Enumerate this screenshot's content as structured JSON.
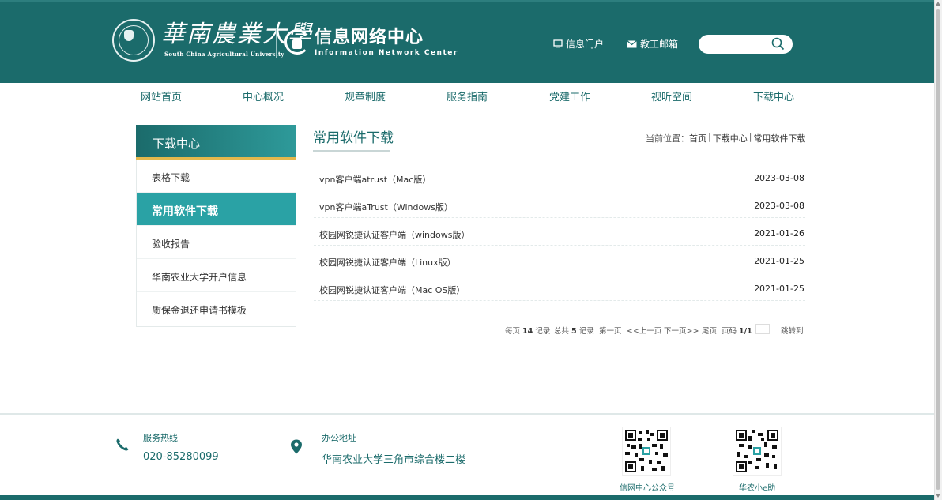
{
  "header": {
    "university_cn": "華南農業大學",
    "university_en": "South China Agricultural University",
    "center_cn": "信息网络中心",
    "center_en": "Information Network Center",
    "links": [
      {
        "label": "信息门户",
        "icon": "monitor-icon"
      },
      {
        "label": "教工邮箱",
        "icon": "mail-icon"
      }
    ],
    "search": {
      "placeholder": "",
      "value": "",
      "icon": "search-icon"
    },
    "colors": {
      "brand": "#1b6b6b",
      "accent": "#2aa2a5",
      "gold": "#e3b84c"
    }
  },
  "nav": {
    "items": [
      {
        "label": "网站首页"
      },
      {
        "label": "中心概况"
      },
      {
        "label": "规章制度"
      },
      {
        "label": "服务指南"
      },
      {
        "label": "党建工作"
      },
      {
        "label": "视听空间"
      },
      {
        "label": "下载中心"
      }
    ]
  },
  "sidebar": {
    "title": "下载中心",
    "items": [
      {
        "label": "表格下载",
        "active": false
      },
      {
        "label": "常用软件下载",
        "active": true
      },
      {
        "label": "验收报告",
        "active": false
      },
      {
        "label": "华南农业大学开户信息",
        "active": false
      },
      {
        "label": "质保金退还申请书模板",
        "active": false
      }
    ]
  },
  "main": {
    "title": "常用软件下载",
    "breadcrumb": {
      "prefix": "当前位置：",
      "items": [
        "首页",
        "下载中心",
        "常用软件下载"
      ],
      "separator": "|"
    },
    "rows": [
      {
        "title": "vpn客户端atrust（Mac版）",
        "date": "2023-03-08"
      },
      {
        "title": "vpn客户端aTrust（Windows版）",
        "date": "2023-03-08"
      },
      {
        "title": "校园网锐捷认证客户端（windows版）",
        "date": "2021-01-26"
      },
      {
        "title": "校园网锐捷认证客户端（Linux版）",
        "date": "2021-01-25"
      },
      {
        "title": "校园网锐捷认证客户端（Mac OS版）",
        "date": "2021-01-25"
      }
    ],
    "pager": {
      "per_page_prefix": "每页",
      "per_page": "14",
      "per_page_suffix": "记录",
      "total_prefix": "总共",
      "total": "5",
      "total_suffix": "记录",
      "first": "第一页",
      "prev": "<<上一页",
      "next": "下一页>>",
      "last": "尾页",
      "page_prefix": "页码",
      "page": "1/1",
      "jump": "跳转到"
    }
  },
  "footer": {
    "hotline_label": "服务热线",
    "hotline": "020-85280099",
    "address_label": "办公地址",
    "address": "华南农业大学三角市综合楼二楼",
    "qr_codes": [
      {
        "caption": "信网中心公众号"
      },
      {
        "caption": "华农小e助"
      }
    ]
  }
}
